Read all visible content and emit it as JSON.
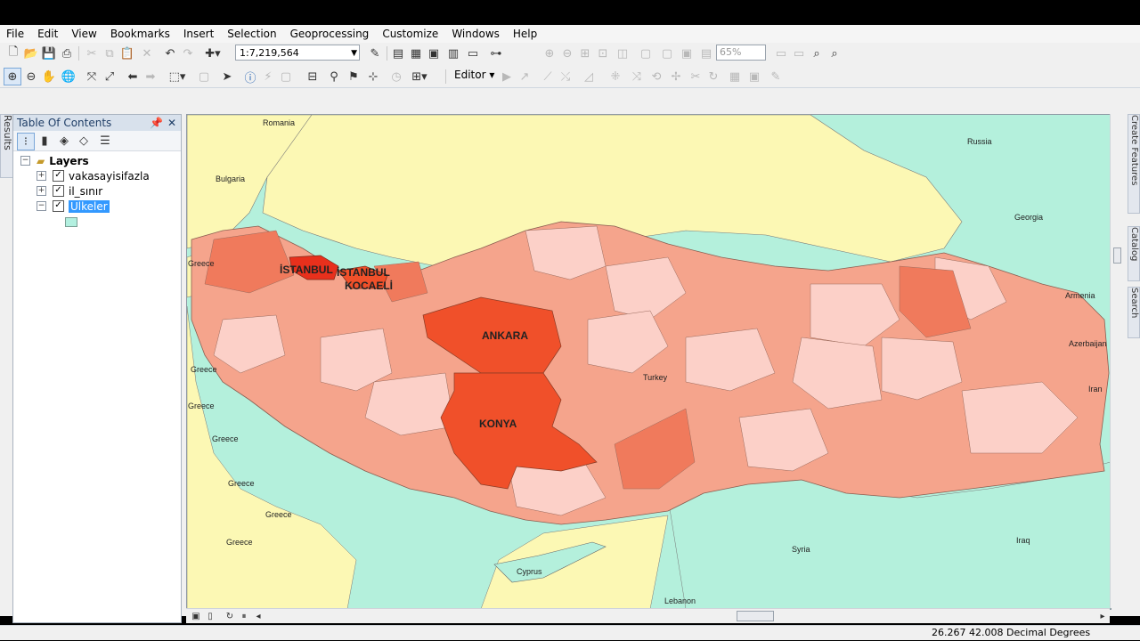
{
  "menu": [
    "File",
    "Edit",
    "View",
    "Bookmarks",
    "Insert",
    "Selection",
    "Geoprocessing",
    "Customize",
    "Windows",
    "Help"
  ],
  "toolbar": {
    "scale_value": "1:7,219,564",
    "zoom_value": "65%",
    "editor_label": "Editor ▾"
  },
  "side_tabs": {
    "left": "Results",
    "right": [
      "Create Features",
      "Catalog",
      "Search"
    ]
  },
  "toc": {
    "title": "Table Of Contents",
    "root": "Layers",
    "layers": [
      {
        "name": "vakasayisifazla",
        "checked": true
      },
      {
        "name": "il_sınır",
        "checked": true
      },
      {
        "name": "Ulkeler",
        "checked": true,
        "selected": true
      }
    ]
  },
  "map": {
    "countries": [
      "Romania",
      "Russia",
      "Bulgaria",
      "Georgia",
      "Greece",
      "Greece",
      "Greece",
      "Greece",
      "Greece",
      "Greece",
      "Greece",
      "Armenia",
      "Azerbaijan",
      "Iran",
      "Turkey",
      "Syria",
      "Iraq",
      "Cyprus",
      "Lebanon"
    ],
    "provinces": [
      "İSTANBUL",
      "İSTANBUL",
      "KOCAELİ",
      "ANKARA",
      "KONYA"
    ],
    "colors": {
      "sea": "#b4f0dc",
      "land": "#fcf8b4",
      "water_black_sea": "#fcf8b4",
      "prov_light": "#fcd0c8",
      "prov_mid": "#f5a48c",
      "prov_dark": "#f07a5c",
      "prov_high": "#f0502a",
      "prov_top": "#e8301c"
    }
  },
  "status": {
    "coordinates": "26.267  42.008 Decimal Degrees"
  }
}
